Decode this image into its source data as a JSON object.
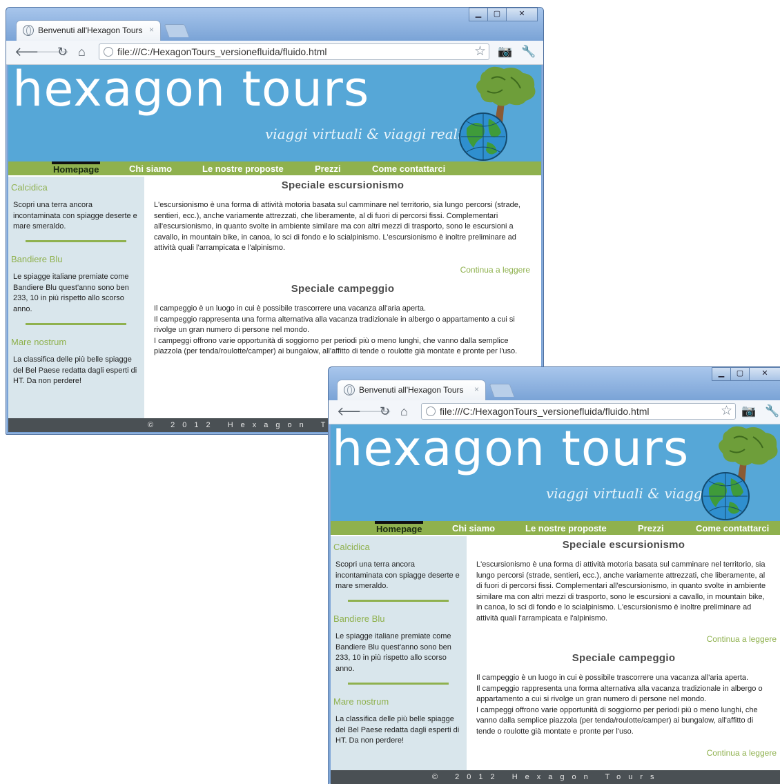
{
  "browser": {
    "tab_title": "Benvenuti all'Hexagon Tours",
    "tab_close": "×",
    "url": "file:///C:/HexagonTours_versionefluida/fluido.html",
    "window_buttons": {
      "minimize": "▁",
      "maximize": "▢",
      "close": "✕"
    }
  },
  "site": {
    "logo": "hexagon tours",
    "tagline": "viaggi virtuali & viaggi reali",
    "nav": [
      "Homepage",
      "Chi siamo",
      "Le nostre proposte",
      "Prezzi",
      "Come contattarci"
    ],
    "active_nav": "Homepage",
    "sidebar": [
      {
        "title": "Calcidica",
        "text": "Scopri una terra ancora incontaminata con spiagge deserte e mare smeraldo."
      },
      {
        "title": "Bandiere Blu",
        "text": "Le spiagge italiane premiate come Bandiere Blu quest'anno sono ben 233, 10 in più rispetto allo scorso anno."
      },
      {
        "title": "Mare nostrum",
        "text": "La classifica delle più belle spiagge del Bel Paese redatta dagli esperti di HT. Da non perdere!"
      }
    ],
    "articles": [
      {
        "title": "Speciale escursionismo",
        "text": "L'escursionismo è una forma di attività motoria basata sul camminare nel territorio, sia lungo percorsi (strade, sentieri, ecc.), anche variamente attrezzati, che liberamente, al di fuori di percorsi fissi. Complementari all'escursionismo, in quanto svolte in ambiente similare ma con altri mezzi di trasporto, sono le escursioni a cavallo, in mountain bike, in canoa, lo sci di fondo e lo scialpinismo. L'escursionismo è inoltre preliminare ad attività quali l'arrampicata e l'alpinismo.",
        "more": "Continua a leggere"
      },
      {
        "title": "Speciale campeggio",
        "lines": [
          "Il campeggio è un luogo in cui è possibile trascorrere una vacanza all'aria aperta.",
          "Il campeggio rappresenta una forma alternativa alla vacanza tradizionale in albergo o appartamento a cui si rivolge un gran numero di persone nel mondo.",
          "I campeggi offrono varie opportunità di soggiorno per periodi più o meno lunghi, che vanno dalla semplice piazzola (per tenda/roulotte/camper) ai bungalow, all'affitto di tende o roulotte già montate e pronte per l'uso."
        ],
        "more": "Continua a leggere"
      }
    ],
    "footer": "© 2012 Hexagon Tours"
  }
}
